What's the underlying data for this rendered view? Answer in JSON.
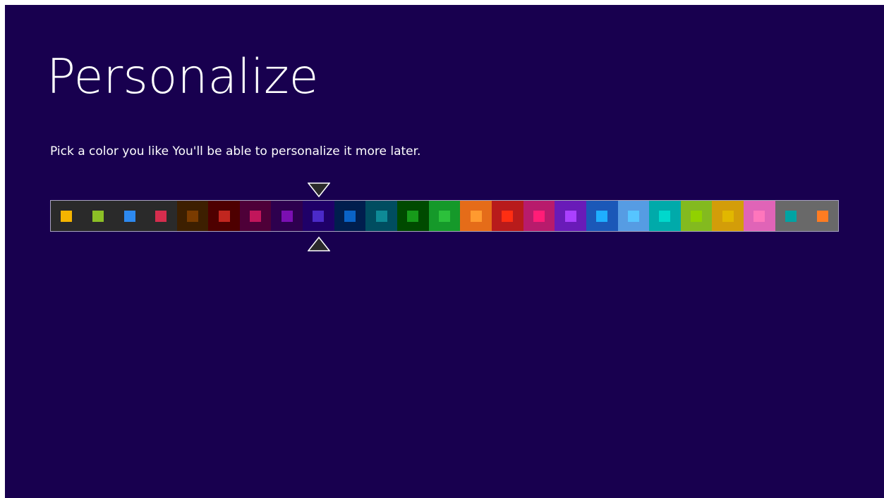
{
  "page": {
    "title": "Personalize",
    "subtitle": "Pick a color you like You'll be able to personalize it more later."
  },
  "colors": {
    "background": "#18004f",
    "selected_index": 8
  },
  "swatches": [
    {
      "bg": "#2a2a2a",
      "chip": "#f4b400"
    },
    {
      "bg": "#2a2a2a",
      "chip": "#8cbf26"
    },
    {
      "bg": "#2a2a2a",
      "chip": "#2d89ef"
    },
    {
      "bg": "#2a2a2a",
      "chip": "#d52d4d"
    },
    {
      "bg": "#3d1f00",
      "chip": "#7a3b00"
    },
    {
      "bg": "#4e0000",
      "chip": "#c1261f"
    },
    {
      "bg": "#4e0038",
      "chip": "#c2165b"
    },
    {
      "bg": "#2d004e",
      "chip": "#7b0fb2"
    },
    {
      "bg": "#1f0068",
      "chip": "#4b2ac8"
    },
    {
      "bg": "#001e4e",
      "chip": "#0a63c7"
    },
    {
      "bg": "#004d60",
      "chip": "#0e8a96"
    },
    {
      "bg": "#004a00",
      "chip": "#179a1a"
    },
    {
      "bg": "#15992a",
      "chip": "#2cc03b"
    },
    {
      "bg": "#e56c19",
      "chip": "#ff9a2f"
    },
    {
      "bg": "#b81b1b",
      "chip": "#ff2e12"
    },
    {
      "bg": "#b81b6c",
      "chip": "#ff1d77"
    },
    {
      "bg": "#691bb8",
      "chip": "#aa40ff"
    },
    {
      "bg": "#1b58b8",
      "chip": "#1faeff"
    },
    {
      "bg": "#569ce3",
      "chip": "#56c5ff"
    },
    {
      "bg": "#00aaaa",
      "chip": "#00d8cc"
    },
    {
      "bg": "#83ba1f",
      "chip": "#91d100"
    },
    {
      "bg": "#d39d09",
      "chip": "#e1b700"
    },
    {
      "bg": "#e064b7",
      "chip": "#ff76bc"
    },
    {
      "bg": "#696969",
      "chip": "#00a3a3"
    },
    {
      "bg": "#696969",
      "chip": "#fe7c22"
    }
  ]
}
